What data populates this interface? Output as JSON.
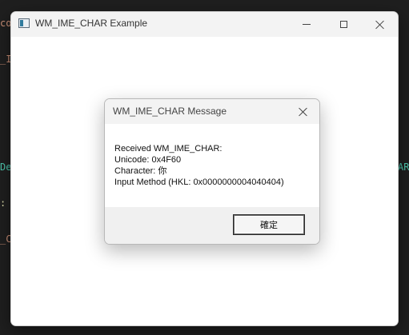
{
  "background_editor": {
    "fragments": [
      "co",
      "_I",
      "De",
      ":",
      "_C",
      "AR"
    ]
  },
  "window": {
    "title": "WM_IME_CHAR Example",
    "icon": "app-window-icon",
    "controls": {
      "minimize_icon": "minimize-icon",
      "maximize_icon": "maximize-icon",
      "close_icon": "close-icon"
    }
  },
  "dialog": {
    "title": "WM_IME_CHAR Message",
    "close_icon": "close-icon",
    "message_lines": [
      "Received WM_IME_CHAR:",
      "Unicode: 0x4F60",
      "Character: 你",
      "Input Method (HKL: 0x0000000004040404)"
    ],
    "ok_label": "確定"
  },
  "colors": {
    "editor_background": "#1f1f1f",
    "window_background": "#ffffff",
    "titlebar_background": "#f3f3f3",
    "dialog_footer": "#f0f0f0"
  }
}
